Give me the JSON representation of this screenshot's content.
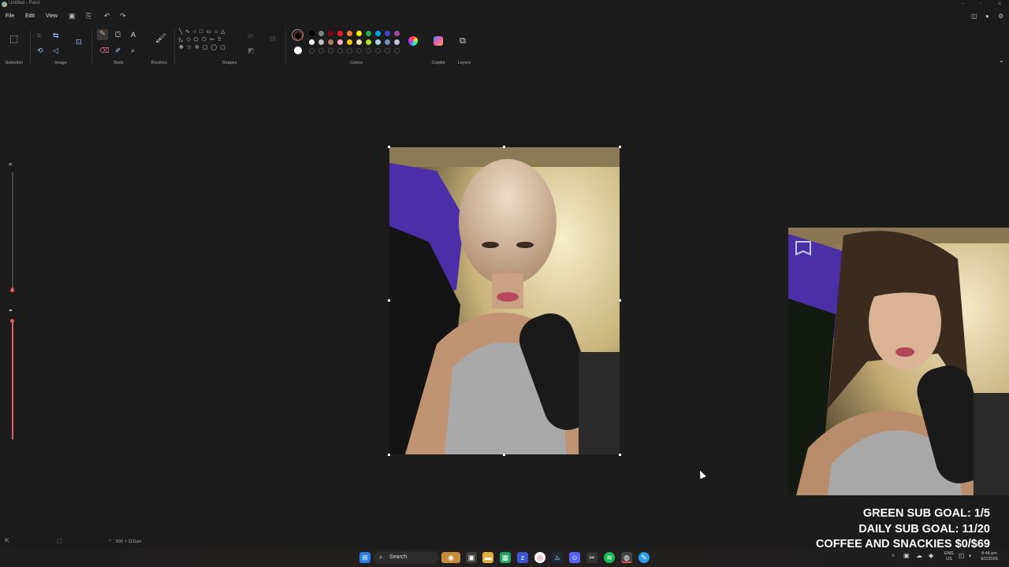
{
  "window": {
    "title": "Untitled - Paint"
  },
  "menu": [
    "File",
    "Edit",
    "View"
  ],
  "ribbon": {
    "groups": {
      "selection": "Selection",
      "image": "Image",
      "tools": "Tools",
      "brushes": "Brushes",
      "shapes": "Shapes",
      "colors": "Colors",
      "copilot": "Copilot",
      "layers": "Layers"
    },
    "shapes_rows": [
      "╲ ∿ ○ □ ▭ ⌂ △",
      "◺ ◇ ⬠ ⬡ ⇦ ⇧",
      "✥ ☆ ✡ ▢ ◯ ▢"
    ],
    "palette_row1": [
      "#000000",
      "#7f7f7f",
      "#880015",
      "#ed1c24",
      "#ff7f27",
      "#fff200",
      "#22b14c",
      "#00a2e8",
      "#3f48cc",
      "#a349a4"
    ],
    "palette_row2": [
      "#ffffff",
      "#c3c3c3",
      "#b97a57",
      "#ffaec9",
      "#ffc90e",
      "#efe4b0",
      "#b5e61d",
      "#99d9ea",
      "#7092be",
      "#c8bfe7"
    ]
  },
  "status": {
    "canvas_size": "830 × 1111px"
  },
  "overlay": {
    "goals": [
      "GREEN SUB GOAL: 1/5",
      "DAILY SUB GOAL: 11/20",
      "COFFEE AND SNACKIES $0/$69"
    ]
  },
  "taskbar": {
    "search_label": "Search",
    "language_top": "ENG",
    "language_bottom": "US",
    "time": "8:48 pm",
    "date": "9/2/2026"
  }
}
